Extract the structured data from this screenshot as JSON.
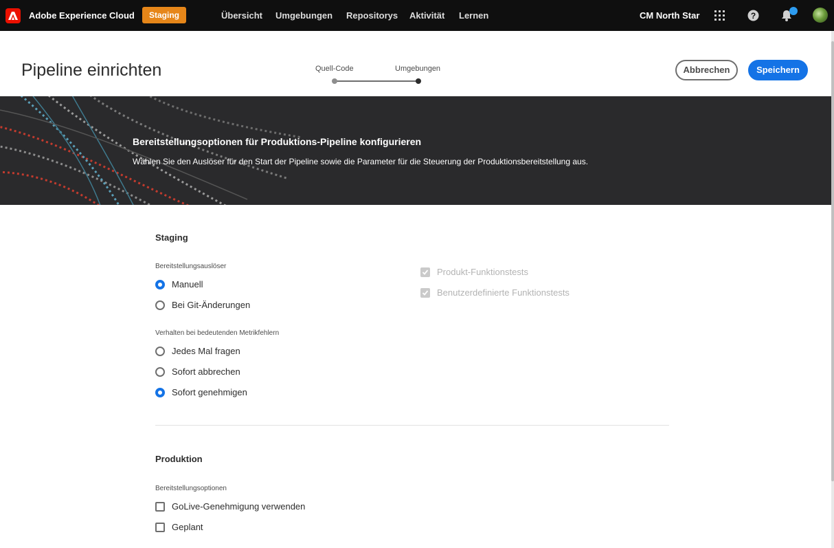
{
  "topbar": {
    "app_title": "Adobe Experience Cloud",
    "env_badge": "Staging",
    "nav": [
      "Übersicht",
      "Umgebungen",
      "Repositorys",
      "Aktivität",
      "Lernen"
    ],
    "org_name": "CM North Star",
    "icons": [
      "adobe-logo-icon",
      "apps-grid-icon",
      "help-icon",
      "bell-icon",
      "avatar"
    ],
    "colors": {
      "bar": "#0f0f0f",
      "badge": "#e68619",
      "logo": "#eb1000",
      "notification": "#2d9cf0"
    }
  },
  "header": {
    "title": "Pipeline einrichten",
    "steps": [
      {
        "label": "Quell-Code",
        "state": "completed"
      },
      {
        "label": "Umgebungen",
        "state": "current"
      }
    ],
    "cancel_label": "Abbrechen",
    "save_label": "Speichern",
    "colors": {
      "primary": "#1473e6"
    }
  },
  "hero": {
    "title": "Bereitstellungsoptionen für Produktions-Pipeline konfigurieren",
    "subtitle": "Wählen Sie den Auslöser für den Start der Pipeline sowie die Parameter für die Steuerung der Produktionsbereitstellung aus."
  },
  "staging": {
    "title": "Staging",
    "trigger_label": "Bereitstellungsauslöser",
    "trigger_options": [
      {
        "label": "Manuell",
        "selected": true
      },
      {
        "label": "Bei Git-Änderungen",
        "selected": false
      }
    ],
    "metric_label": "Verhalten bei bedeutenden Metrikfehlern",
    "metric_options": [
      {
        "label": "Jedes Mal fragen",
        "selected": false
      },
      {
        "label": "Sofort abbrechen",
        "selected": false
      },
      {
        "label": "Sofort genehmigen",
        "selected": true
      }
    ],
    "tests": [
      {
        "label": "Produkt-Funktionstests",
        "checked": true,
        "disabled": true
      },
      {
        "label": "Benutzerdefinierte Funktionstests",
        "checked": true,
        "disabled": true
      }
    ]
  },
  "production": {
    "title": "Produktion",
    "options_label": "Bereitstellungsoptionen",
    "options": [
      {
        "label": "GoLive-Genehmigung verwenden",
        "checked": false
      },
      {
        "label": "Geplant",
        "checked": false
      }
    ]
  }
}
